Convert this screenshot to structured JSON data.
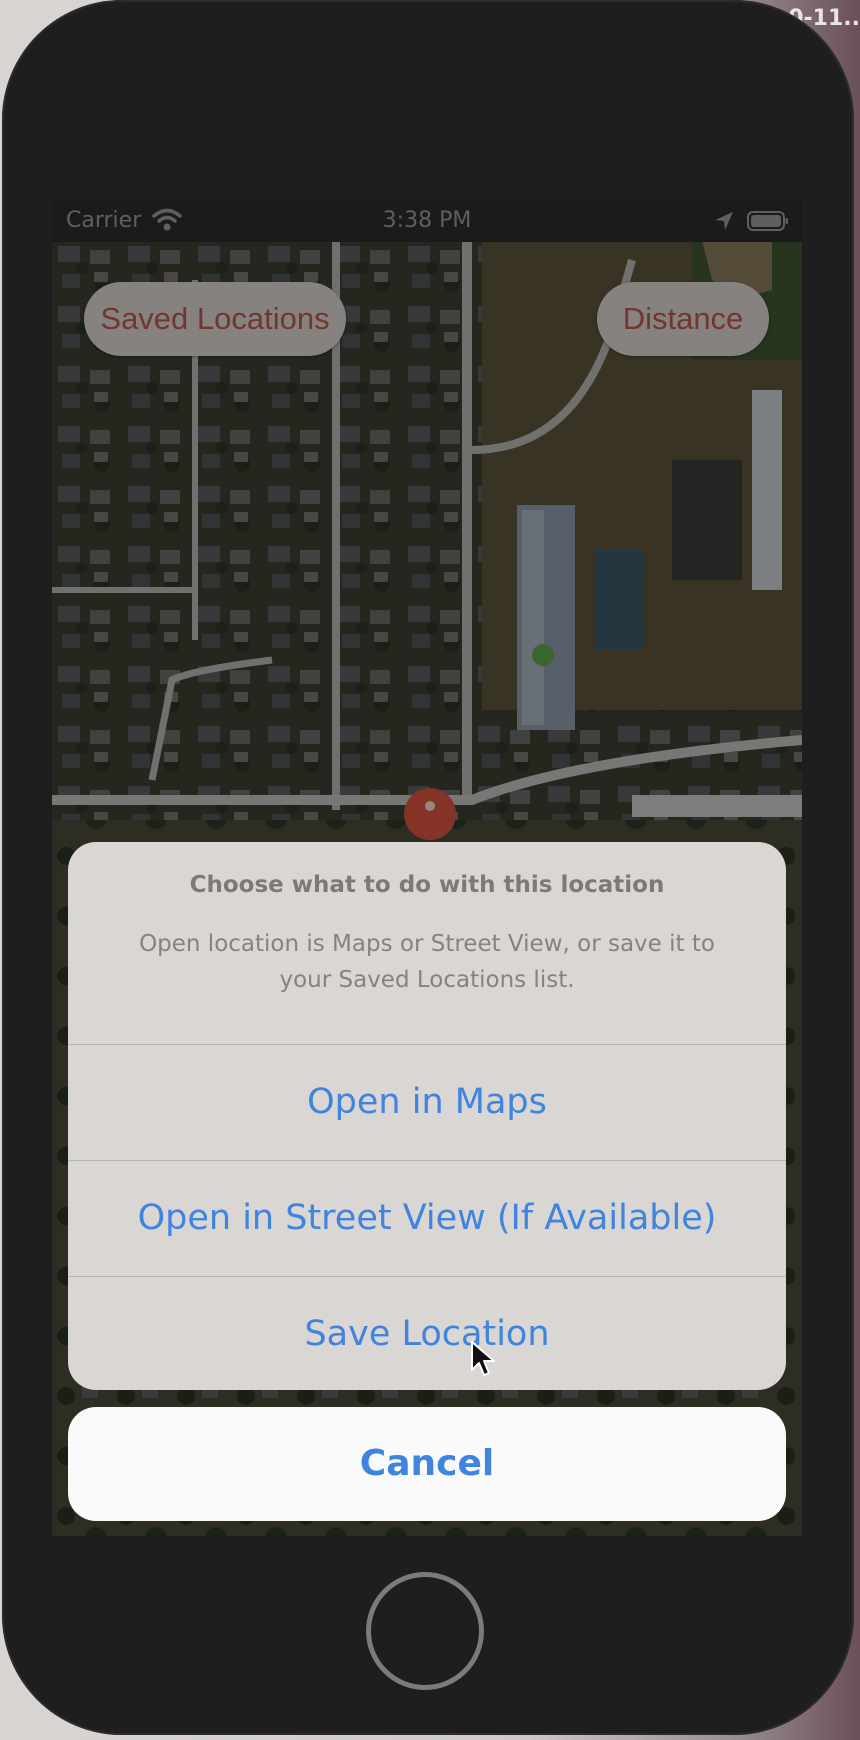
{
  "desktop": {
    "label": "0-11.."
  },
  "status_bar": {
    "carrier": "Carrier",
    "time": "3:38 PM"
  },
  "map": {
    "buttons": {
      "saved_locations": "Saved Locations",
      "distance": "Distance"
    }
  },
  "action_sheet": {
    "title": "Choose what to do with this location",
    "message": "Open location is Maps or Street View, or save it to your Saved Locations list.",
    "actions": [
      {
        "label": "Open in Maps"
      },
      {
        "label": "Open in Street View (If Available)"
      },
      {
        "label": "Save Location"
      }
    ],
    "cancel_label": "Cancel"
  },
  "colors": {
    "accent_blue": "#3f84de",
    "pill_text_red": "#b8574b",
    "pin_red": "#d9533f"
  }
}
